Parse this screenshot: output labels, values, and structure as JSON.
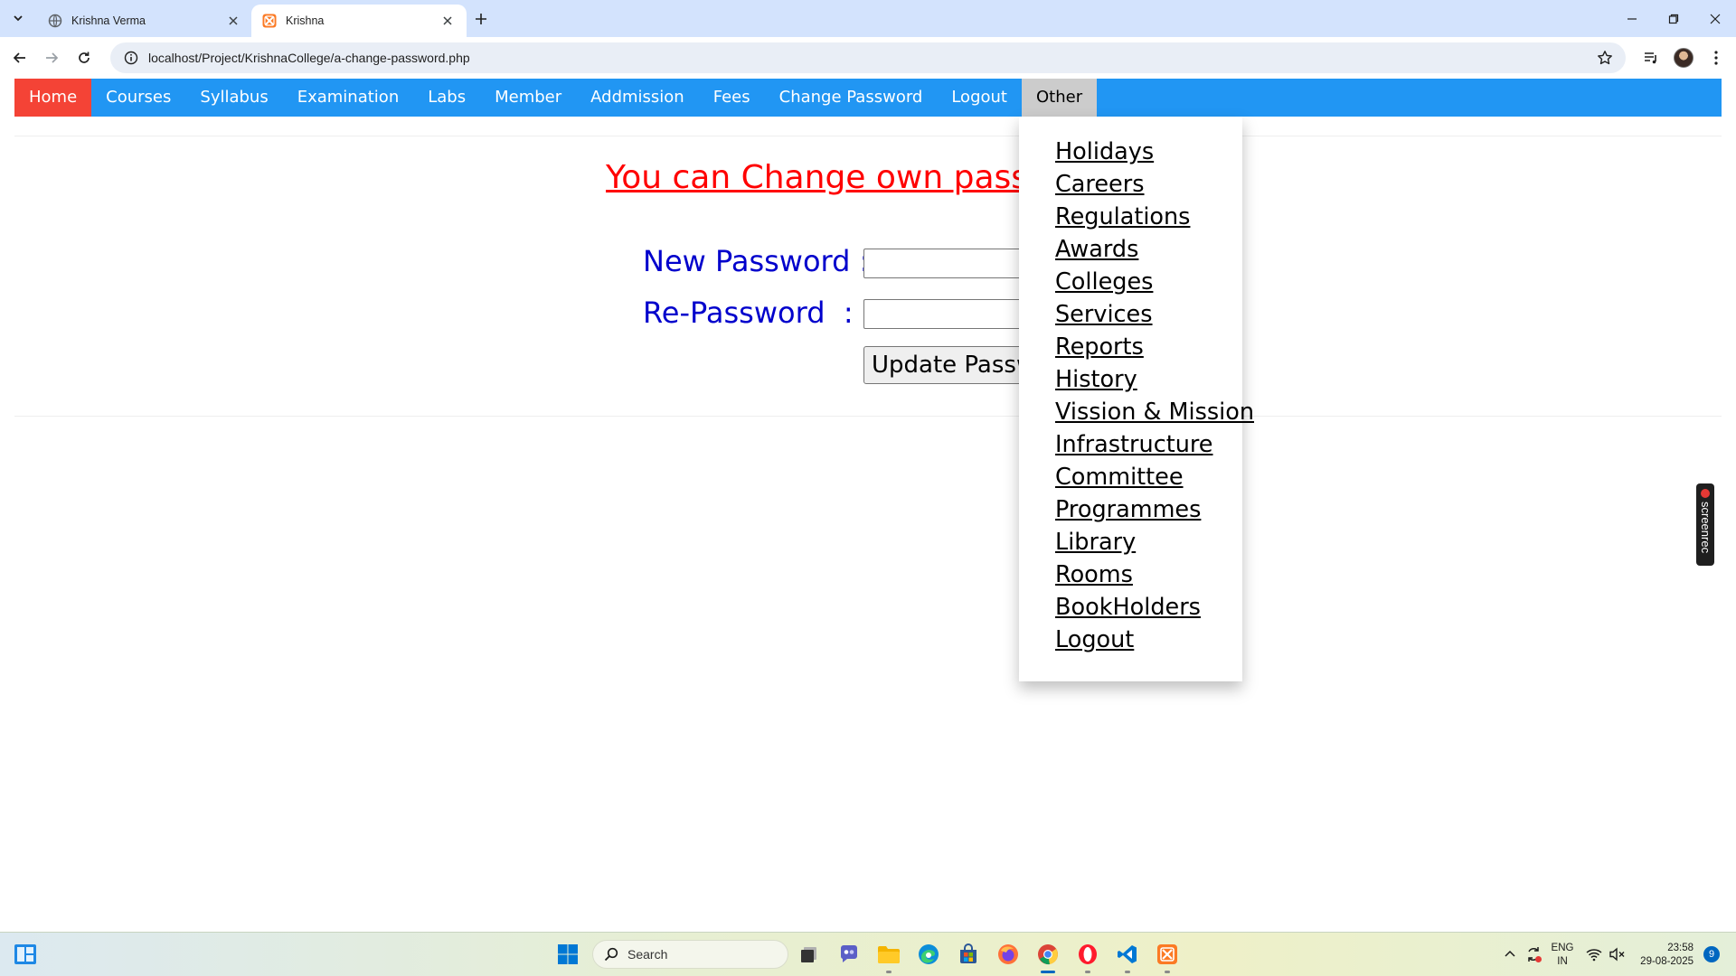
{
  "browser": {
    "tabs": [
      {
        "title": "Krishna Verma",
        "icon": "globe-icon",
        "active": false
      },
      {
        "title": "Krishna",
        "icon": "xampp-icon",
        "active": true
      }
    ],
    "url": "localhost/Project/KrishnaCollege/a-change-password.php"
  },
  "navbar": {
    "items": [
      {
        "label": "Home",
        "active": true
      },
      {
        "label": "Courses"
      },
      {
        "label": "Syllabus"
      },
      {
        "label": "Examination"
      },
      {
        "label": "Labs"
      },
      {
        "label": "Member"
      },
      {
        "label": "Addmission"
      },
      {
        "label": "Fees"
      },
      {
        "label": "Change Password"
      },
      {
        "label": "Logout"
      },
      {
        "label": "Other",
        "open": true
      }
    ]
  },
  "form": {
    "heading": "You can Change own password",
    "new_password_label": "New Password :",
    "re_password_label": "Re-Password  :",
    "new_password_value": "",
    "re_password_value": "",
    "submit_label": "Update Password"
  },
  "dropdown": {
    "items": [
      "Holidays",
      "Careers",
      "Regulations",
      "Awards",
      "Colleges",
      "Services",
      "Reports",
      "History",
      "Vission & Mission",
      "Infrastructure",
      "Committee",
      "Programmes",
      "Library",
      "Rooms",
      "BookHolders",
      "Logout"
    ]
  },
  "overlay": {
    "screenrec_label": "screenrec"
  },
  "taskbar": {
    "search_placeholder": "Search",
    "language": "ENG",
    "region": "IN",
    "time": "23:58",
    "date": "29-08-2025",
    "notification_count": "9"
  },
  "colors": {
    "navbar_bg": "#2196f3",
    "navbar_active": "#f44336",
    "heading": "#ff0000",
    "label": "#0000cc"
  }
}
